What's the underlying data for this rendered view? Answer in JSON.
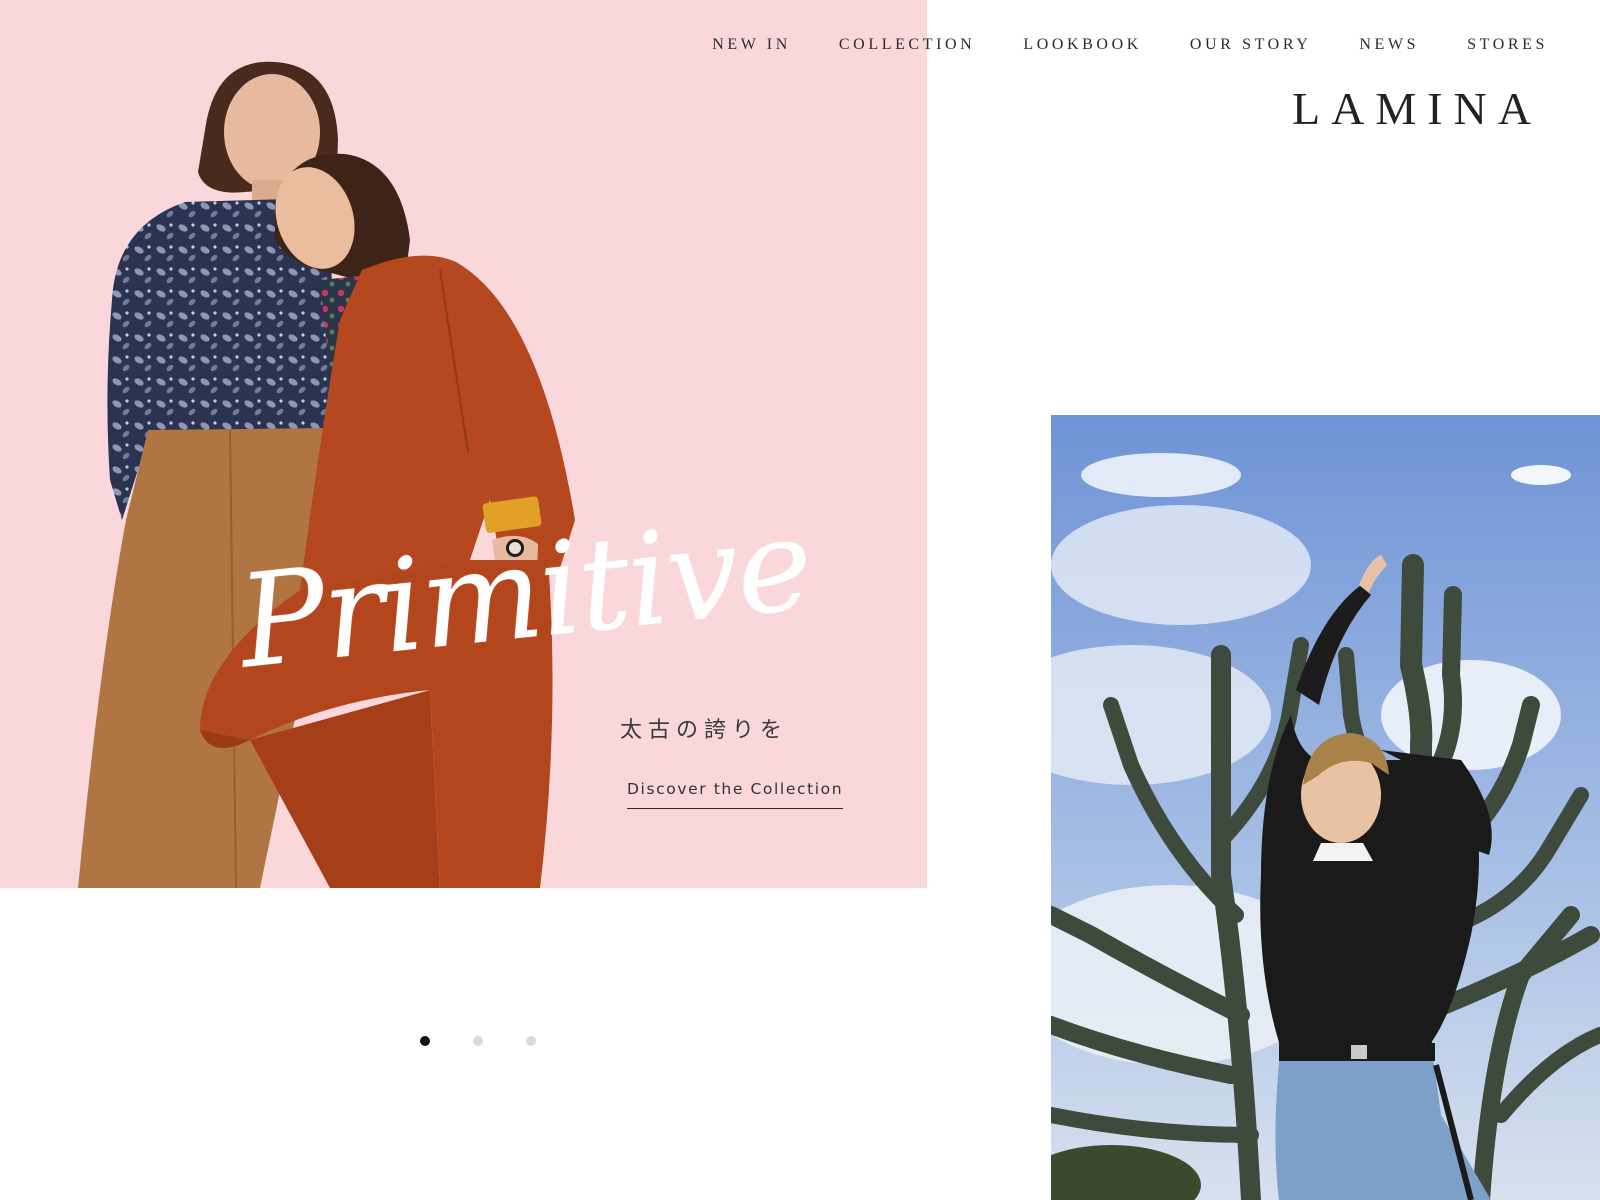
{
  "brand": {
    "logo_text": "LAMINA"
  },
  "nav": {
    "items": [
      {
        "label": "NEW IN",
        "name": "nav-item-new-in"
      },
      {
        "label": "COLLECTION",
        "name": "nav-item-collection"
      },
      {
        "label": "LOOKBOOK",
        "name": "nav-item-lookbook"
      },
      {
        "label": "OUR STORY",
        "name": "nav-item-our-story"
      },
      {
        "label": "NEWS",
        "name": "nav-item-news"
      },
      {
        "label": "STORES",
        "name": "nav-item-stores"
      }
    ]
  },
  "hero": {
    "title": "Primitive",
    "subtitle": "太古の誇りを",
    "cta_label": "Discover the Collection",
    "background_color": "#f9d7da"
  },
  "carousel": {
    "slide_count": 3,
    "active_index": 0
  },
  "colors": {
    "pink": "#f9d7da",
    "text_dark": "#2a2a2a",
    "dot_active": "#111111",
    "dot_inactive": "#d9d9d9"
  }
}
